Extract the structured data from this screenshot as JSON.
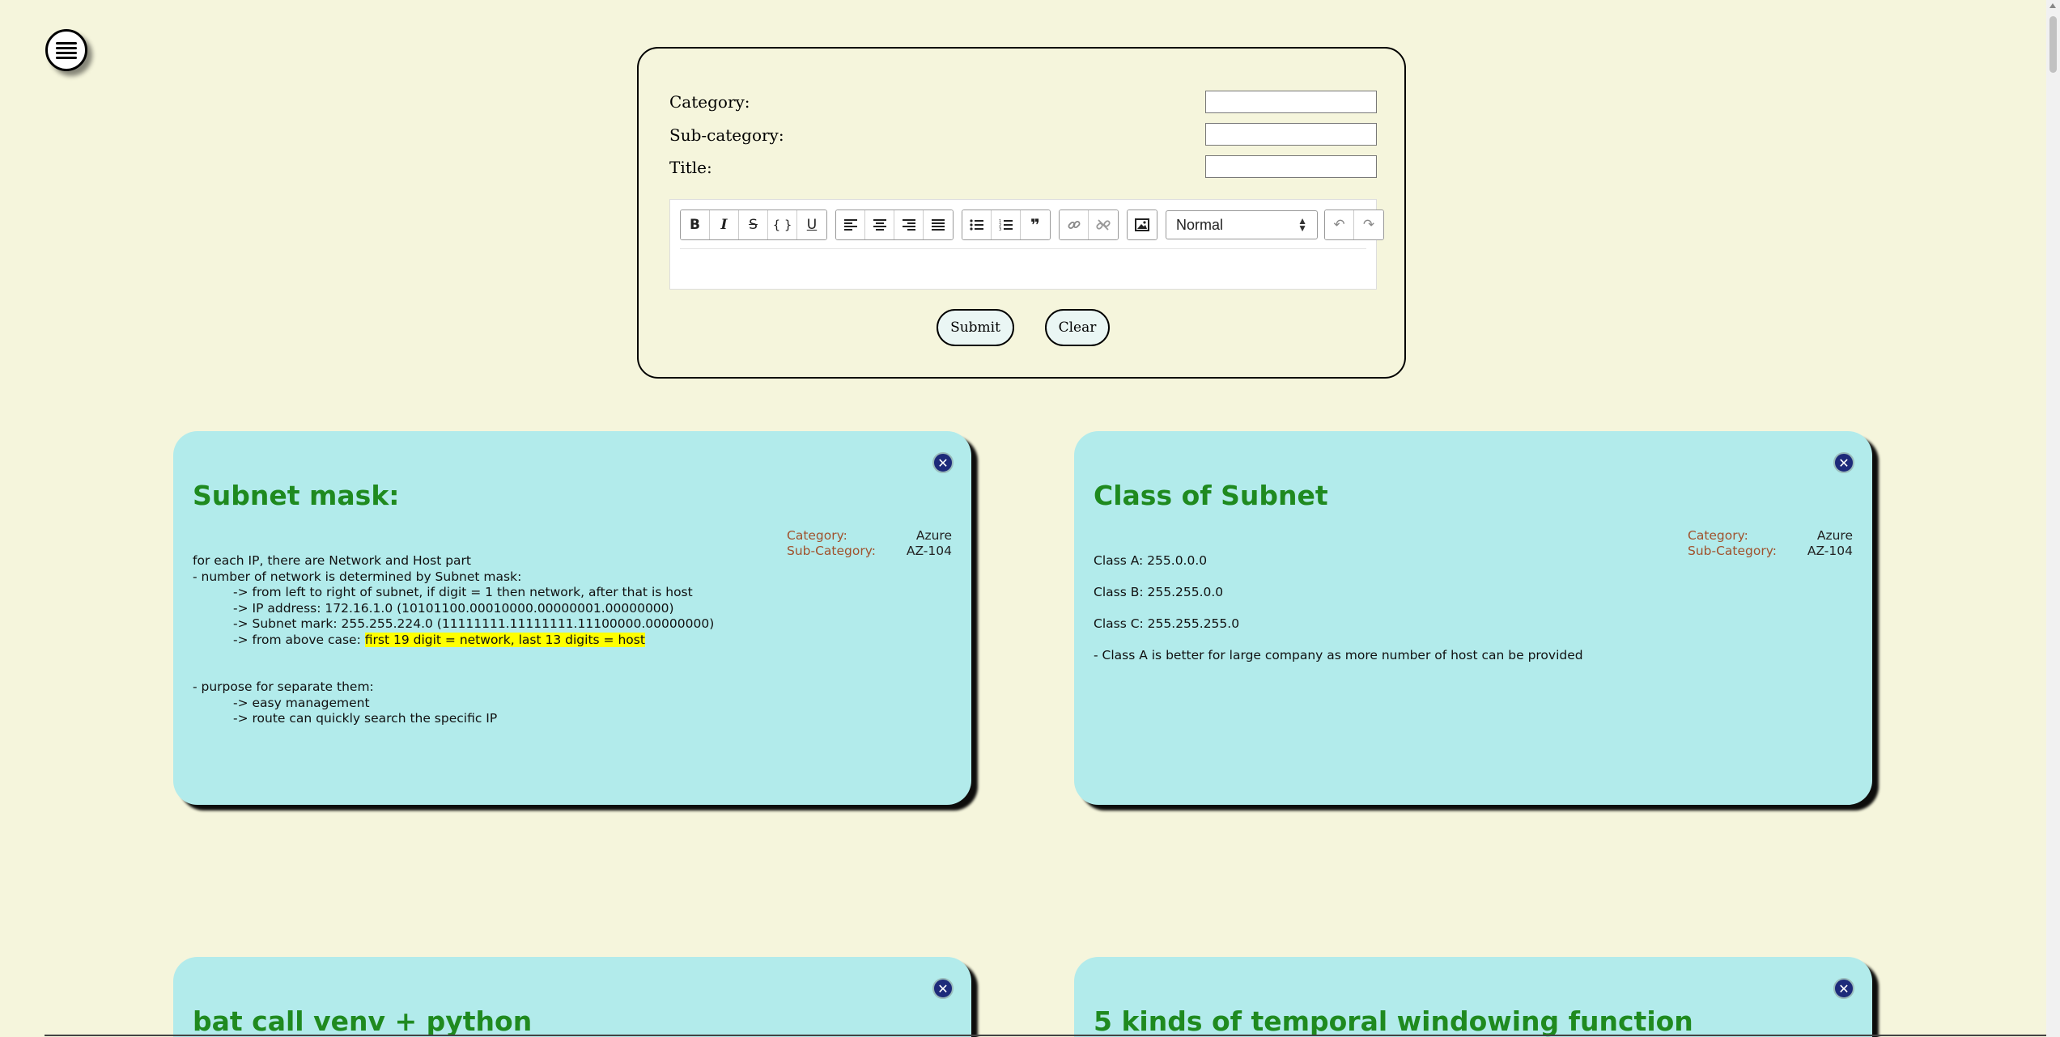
{
  "form": {
    "category_label": "Category:",
    "subcategory_label": "Sub-category:",
    "title_label": "Title:",
    "category_value": "",
    "subcategory_value": "",
    "title_value": "",
    "format_select": "Normal",
    "submit_label": "Submit",
    "clear_label": "Clear"
  },
  "cards": [
    {
      "close": "✕",
      "title": "Subnet mask:",
      "category_label": "Category:",
      "category": "Azure",
      "subcategory_label": "Sub-Category:",
      "subcategory": "AZ-104",
      "lines": [
        "for each IP, there are Network and Host part",
        "- number of network is determined by Subnet mask:",
        "-> from left to right of subnet, if digit = 1 then network, after that is host",
        "-> IP address: 172.16.1.0 (10101100.00010000.00000001.00000000)",
        "-> Subnet mark: 255.255.224.0 (11111111.11111111.11100000.00000000)",
        "-> from above case: ",
        "first 19 digit = network, last 13 digits = host",
        "- purpose for separate them:",
        "-> easy management",
        "-> route can quickly search the specific IP"
      ]
    },
    {
      "close": "✕",
      "title": "Class of Subnet",
      "category_label": "Category:",
      "category": "Azure",
      "subcategory_label": "Sub-Category:",
      "subcategory": "AZ-104",
      "lines": [
        "Class A: 255.0.0.0",
        "Class B: 255.255.0.0",
        "Class C: 255.255.255.0",
        "- Class A is better for large company as more number of host can be provided"
      ]
    },
    {
      "close": "✕",
      "title": "bat call venv + python"
    },
    {
      "close": "✕",
      "title": "5 kinds of temporal windowing function"
    }
  ],
  "colors": {
    "background": "#f5f5dc",
    "card": "#b2ebeb",
    "title": "#1f8a1f",
    "meta_key": "#a0522d",
    "highlight": "#ffff00",
    "close": "#1d2a7a"
  },
  "icons": {
    "menu": "hamburger-icon",
    "close": "close-circle-icon"
  }
}
